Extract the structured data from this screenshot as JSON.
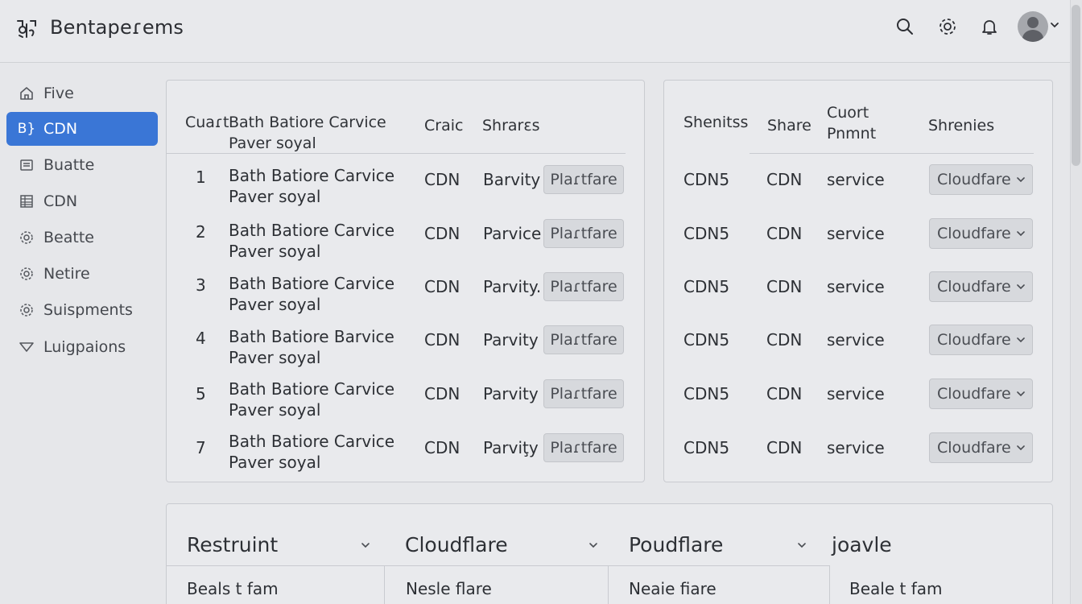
{
  "app": {
    "title": "Bentapeɾems"
  },
  "topbar": {
    "icons": [
      "search-icon",
      "settings-icon",
      "bell-icon",
      "avatar"
    ]
  },
  "sidebar": {
    "items": [
      {
        "label": "Five",
        "icon": "home-icon"
      },
      {
        "label": "CDN",
        "icon": "code-icon",
        "prefix": "B}",
        "active": true
      },
      {
        "label": "Buatte",
        "icon": "list-icon"
      },
      {
        "label": "CDN",
        "icon": "table-icon"
      },
      {
        "label": "Beatte",
        "icon": "gear-icon"
      },
      {
        "label": "Netire",
        "icon": "gear-icon"
      },
      {
        "label": "Suispments",
        "icon": "gear-icon"
      },
      {
        "label": "Luigpaions",
        "icon": "triangle-icon"
      }
    ]
  },
  "left_table": {
    "headers": {
      "col1": "Cuaɾt",
      "name_line1": "Bath Batiore Carvice",
      "name_line2": "Paver soyal",
      "col3": "Craic",
      "col4": "Shrarɛs"
    },
    "rows": [
      {
        "num": "1",
        "name1": "Bath Batiore Carvice",
        "name2": "Paver soyal",
        "cdn": "CDN",
        "status": "Barvity",
        "button": "Plaɾtfare"
      },
      {
        "num": "2",
        "name1": "Bath Batiore Carvice",
        "name2": "Paver soyal",
        "cdn": "CDN",
        "status": "Parvice",
        "button": "Plaɾtfare"
      },
      {
        "num": "3",
        "name1": "Bath Batiore Carvice",
        "name2": "Paver soyal",
        "cdn": "CDN",
        "status": "Parvity.",
        "button": "Plaɾtfare"
      },
      {
        "num": "4",
        "name1": "Bath Batiore Barvice",
        "name2": "Paver soyal",
        "cdn": "CDN",
        "status": "Parvity",
        "button": "Plaɾtfare"
      },
      {
        "num": "5",
        "name1": "Bath Batiore Carvice",
        "name2": "Paver soyal",
        "cdn": "CDN",
        "status": "Parvity",
        "button": "Plaɾtfare"
      },
      {
        "num": "7",
        "name1": "Bath Batiore Carvice",
        "name2": "Paver soyal",
        "cdn": "CDN",
        "status": "Parviţy",
        "button": "Plaɾtfare"
      }
    ]
  },
  "right_table": {
    "headers": {
      "col1": "Shenitss",
      "col2": "Share",
      "col3_line1": "Cuort",
      "col3_line2": "Pnmnt",
      "col4": "Shrenies"
    },
    "rows": [
      {
        "c1": "CDN5",
        "c2": "CDN",
        "c3": "service",
        "select": "Cloudfare"
      },
      {
        "c1": "CDN5",
        "c2": "CDN",
        "c3": "service",
        "select": "Cloudfare"
      },
      {
        "c1": "CDN5",
        "c2": "CDN",
        "c3": "service",
        "select": "Cloudfare"
      },
      {
        "c1": "CDN5",
        "c2": "CDN",
        "c3": "service",
        "select": "Cloudfare"
      },
      {
        "c1": "CDN5",
        "c2": "CDN",
        "c3": "service",
        "select": "Cloudfare"
      },
      {
        "c1": "CDN5",
        "c2": "CDN",
        "c3": "service",
        "select": "Cloudfare"
      }
    ]
  },
  "bottom_panel": {
    "dropdowns": [
      "Restruint",
      "Cloudflare",
      "Poudflare",
      "joavle"
    ],
    "cells": [
      "Beals t fam",
      "Nesle flare",
      "Neaie fiare",
      "Beale t fam"
    ]
  }
}
